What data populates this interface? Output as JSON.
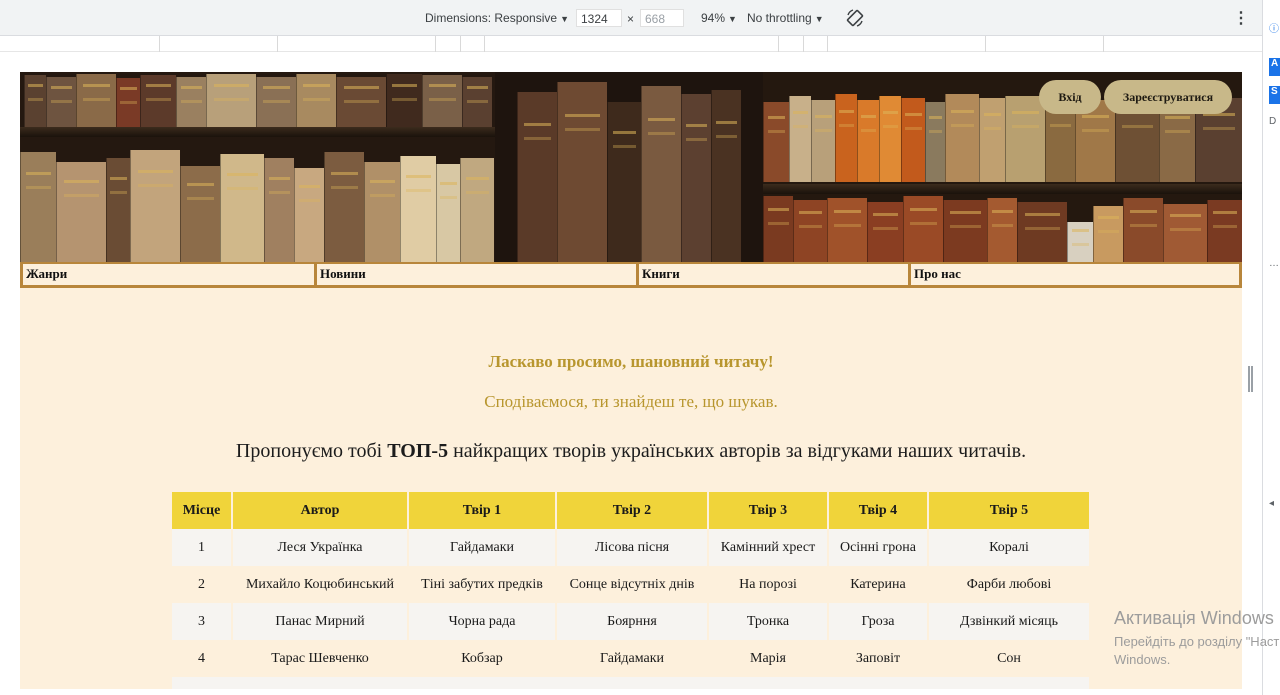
{
  "devtools": {
    "dimensions_label": "Dimensions: Responsive",
    "width_value": "1324",
    "times": "×",
    "height_placeholder": "668",
    "zoom": "94%",
    "throttling": "No throttling",
    "rotate_icon": "rotate-icon",
    "menu_icon": "kebab-menu-icon"
  },
  "header": {
    "login_label": "Вхід",
    "register_label": "Зареєструватися"
  },
  "nav": {
    "items": [
      {
        "label": "Жанри"
      },
      {
        "label": "Новини"
      },
      {
        "label": "Книги"
      },
      {
        "label": "Про нас"
      }
    ]
  },
  "welcome": {
    "title": "Ласкаво просимо, шановний читачу!",
    "subtitle": "Сподіваємося, ти знайдеш те, що шукав."
  },
  "intro": {
    "before": "Пропонуємо тобі ",
    "highlight": "ТОП-5",
    "after": " найкращих творів українських авторів за відгуками наших читачів."
  },
  "table": {
    "headers": [
      "Місце",
      "Автор",
      "Твір 1",
      "Твір 2",
      "Твір 3",
      "Твір 4",
      "Твір 5"
    ],
    "rows": [
      [
        "1",
        "Леся Українка",
        "Гайдамаки",
        "Лісова пісня",
        "Камінний хрест",
        "Осінні грона",
        "Коралі"
      ],
      [
        "2",
        "Михайло Коцюбинський",
        "Тіні забутих предків",
        "Сонце відсутніх днів",
        "На порозі",
        "Катерина",
        "Фарби любові"
      ],
      [
        "3",
        "Панас Мирний",
        "Чорна рада",
        "Боярння",
        "Тронка",
        "Гроза",
        "Дзвінкий місяць"
      ],
      [
        "4",
        "Тарас Шевченко",
        "Кобзар",
        "Гайдамаки",
        "Марія",
        "Заповіт",
        "Сон"
      ]
    ]
  },
  "watermark": {
    "title": "Активація Windows",
    "line1": "Перейдіть до розділу \"Настройки\"",
    "line2": "Windows."
  },
  "colors": {
    "page_bg": "#fdf0dc",
    "nav_border": "#b8863b",
    "accent_text": "#b8962e",
    "table_header": "#f0d43a",
    "button_bg": "#c8b889"
  }
}
